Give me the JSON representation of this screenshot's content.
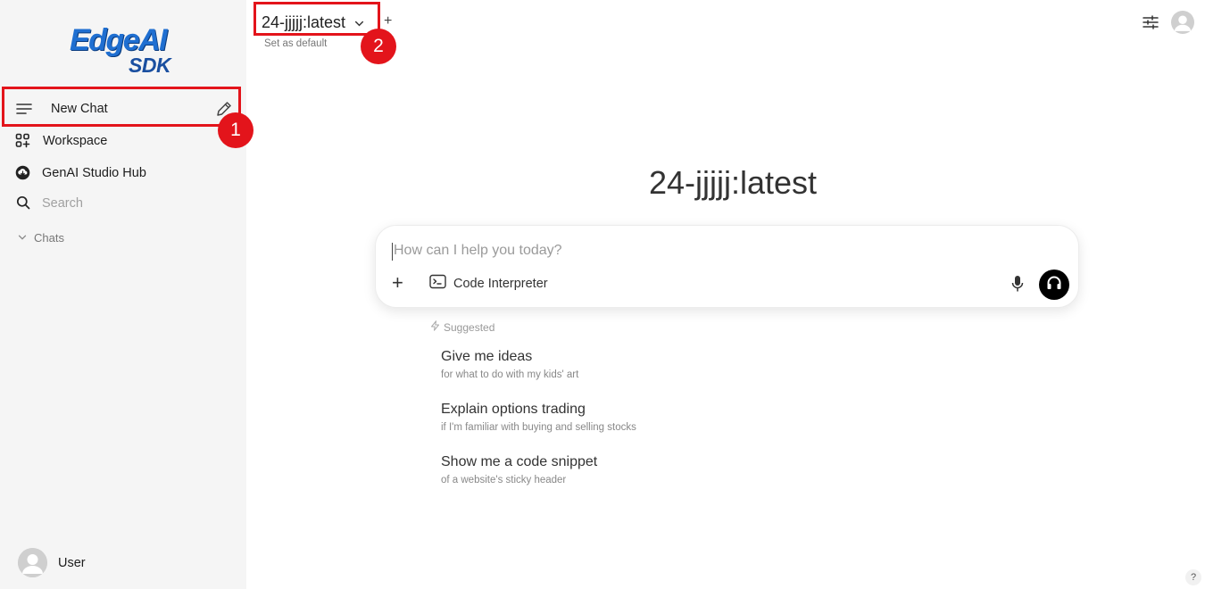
{
  "sidebar": {
    "logo": {
      "line1": "EdgeAI",
      "line2": "SDK"
    },
    "new_chat_label": "New Chat",
    "items": [
      {
        "label": "Workspace",
        "icon": "workspace-icon"
      },
      {
        "label": "GenAI Studio Hub",
        "icon": "cloud-download-icon"
      }
    ],
    "search_placeholder": "Search",
    "chats_label": "Chats",
    "user_name": "User"
  },
  "header": {
    "model_name": "24-jjjjj:latest",
    "set_default": "Set as default",
    "add_model": "+"
  },
  "main": {
    "title": "24-jjjjj:latest",
    "input_placeholder": "How can I help you today?",
    "add_button": "+",
    "tool_label": "Code Interpreter",
    "suggested_label": "Suggested",
    "suggestions": [
      {
        "title": "Give me ideas",
        "subtitle": "for what to do with my kids' art"
      },
      {
        "title": "Explain options trading",
        "subtitle": "if I'm familiar with buying and selling stocks"
      },
      {
        "title": "Show me a code snippet",
        "subtitle": "of a website's sticky header"
      }
    ]
  },
  "annotations": {
    "badge1": "1",
    "badge2": "2"
  },
  "help": "?",
  "colors": {
    "highlight": "#e3141b",
    "logo_blue": "#1f6fd1",
    "sidebar_bg": "#f5f5f5"
  }
}
